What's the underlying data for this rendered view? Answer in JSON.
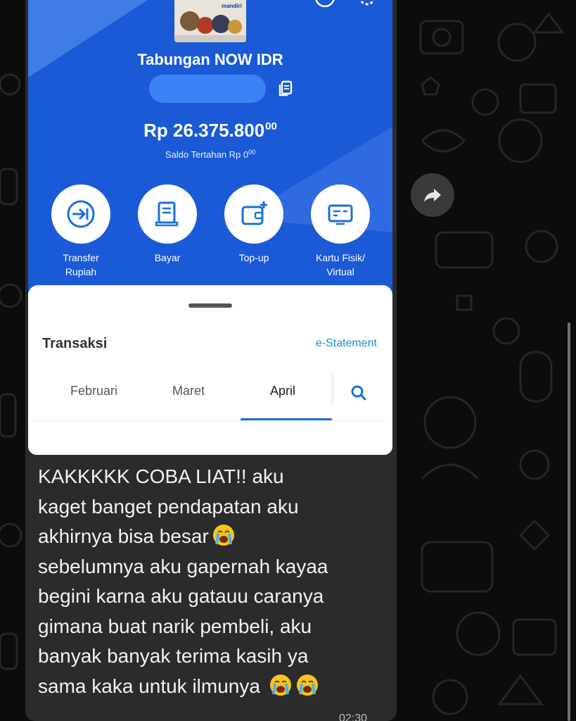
{
  "colors": {
    "hero_blue": "#1a5ad6",
    "accent_blue": "#1a70d6",
    "bubble_bg": "#2b2b2b",
    "chat_bg": "#0c0c0c"
  },
  "banking_app": {
    "account_name": "Tabungan NOW IDR",
    "card_brand": "mandiri",
    "balance_main": "Rp 26.375.800",
    "balance_cents": "00",
    "held_balance_label": "Saldo Tertahan",
    "held_balance_main": "Rp 0",
    "held_balance_cents": "00",
    "actions": [
      {
        "label_line1": "Transfer",
        "label_line2": "Rupiah",
        "icon": "transfer-icon"
      },
      {
        "label_line1": "Bayar",
        "label_line2": "",
        "icon": "bill-icon"
      },
      {
        "label_line1": "Top-up",
        "label_line2": "",
        "icon": "wallet-topup-icon"
      },
      {
        "label_line1": "Kartu Fisik/",
        "label_line2": "Virtual",
        "icon": "card-icon"
      }
    ],
    "transactions_title": "Transaksi",
    "estatement_link": "e-Statement",
    "month_tabs": [
      "Februari",
      "Maret",
      "April"
    ],
    "active_tab": "April"
  },
  "chat": {
    "message_lines": [
      "KAKKKKK COBA LIAT!! aku",
      "kaget banget pendapatan aku",
      "akhirnya bisa besar",
      "sebelumnya aku gapernah kayaa",
      "begini karna aku gatauu caranya",
      "gimana buat narik pembeli, aku",
      "banyak banyak terima kasih ya",
      "sama kaka untuk ilmunya"
    ],
    "emoji": "loudly-crying-face",
    "time_partial": "02:30"
  }
}
